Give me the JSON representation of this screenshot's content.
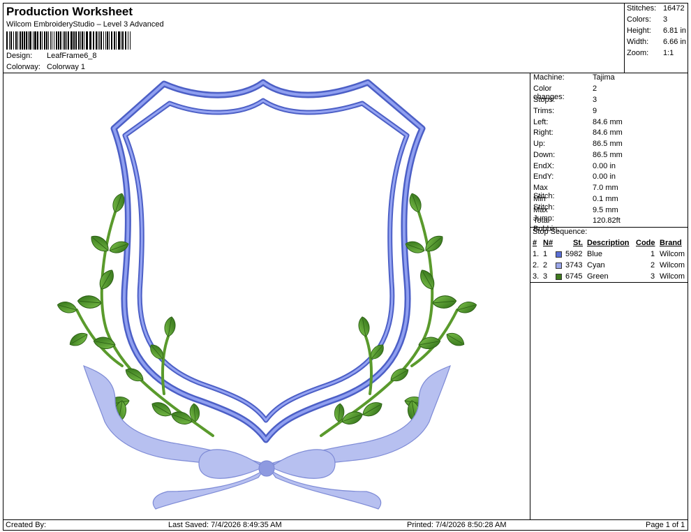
{
  "header": {
    "title": "Production Worksheet",
    "subtitle": "Wilcom EmbroideryStudio – Level 3 Advanced",
    "design_label": "Design:",
    "design_value": "LeafFrame6_8",
    "colorway_label": "Colorway:",
    "colorway_value": "Colorway 1"
  },
  "stats": [
    {
      "label": "Stitches:",
      "value": "16472"
    },
    {
      "label": "Colors:",
      "value": "3"
    },
    {
      "label": "Height:",
      "value": "6.81 in"
    },
    {
      "label": "Width:",
      "value": "6.66 in"
    },
    {
      "label": "Zoom:",
      "value": "1:1"
    }
  ],
  "machine_info": [
    {
      "label": "Machine:",
      "value": "Tajima"
    },
    {
      "label": "Color changes:",
      "value": "2"
    },
    {
      "label": "Stops:",
      "value": "3"
    },
    {
      "label": "Trims:",
      "value": "9"
    },
    {
      "label": "Left:",
      "value": "84.6 mm"
    },
    {
      "label": "Right:",
      "value": "84.6 mm"
    },
    {
      "label": "Up:",
      "value": "86.5 mm"
    },
    {
      "label": "Down:",
      "value": "86.5 mm"
    },
    {
      "label": "EndX:",
      "value": "0.00 in"
    },
    {
      "label": "EndY:",
      "value": "0.00 in"
    },
    {
      "label": "Max Stitch:",
      "value": "7.0 mm"
    },
    {
      "label": "Min Stitch:",
      "value": "0.1 mm"
    },
    {
      "label": "Max Jump:",
      "value": "9.5 mm"
    },
    {
      "label": "Total Bobbin:",
      "value": "120.82ft"
    }
  ],
  "stop_sequence": {
    "title": "Stop Sequence:",
    "headers": {
      "num": "#",
      "n": "N#",
      "st": "St.",
      "description": "Description",
      "code": "Code",
      "brand": "Brand"
    },
    "rows": [
      {
        "num": "1.",
        "n": "1",
        "color": "#5a6fd6",
        "st": "5982",
        "description": "Blue",
        "code": "1",
        "brand": "Wilcom"
      },
      {
        "num": "2.",
        "n": "2",
        "color": "#9aa6e8",
        "st": "3743",
        "description": "Cyan",
        "code": "2",
        "brand": "Wilcom"
      },
      {
        "num": "3.",
        "n": "3",
        "color": "#3f7a1e",
        "st": "6745",
        "description": "Green",
        "code": "3",
        "brand": "Wilcom"
      }
    ]
  },
  "footer": {
    "created_by": "Created By:",
    "last_saved": "Last Saved: 7/4/2026 8:49:35 AM",
    "printed": "Printed: 7/4/2026 8:50:28 AM",
    "page": "Page 1 of 1"
  },
  "colors": {
    "frame_blue": "#6c7fdc",
    "ribbon": "#aeb8ee",
    "leaf_green": "#4e9a2c",
    "stem_green": "#6fae3a"
  }
}
